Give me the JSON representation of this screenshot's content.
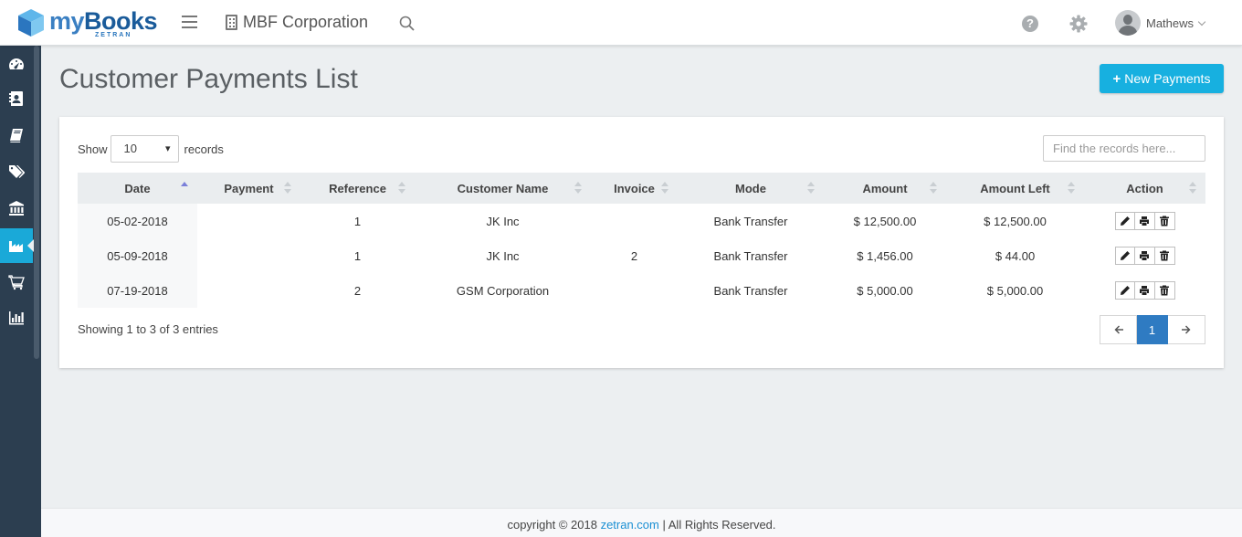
{
  "brand": {
    "name_my": "my",
    "name_books": "Books",
    "sub": "ZETRAN"
  },
  "header": {
    "company": "MBF Corporation",
    "user": "Mathews"
  },
  "sidebar": {
    "items": [
      {
        "icon": "dashboard-icon"
      },
      {
        "icon": "contacts-icon"
      },
      {
        "icon": "book-icon"
      },
      {
        "icon": "tags-icon"
      },
      {
        "icon": "bank-icon"
      },
      {
        "icon": "factory-icon",
        "active": true
      },
      {
        "icon": "cart-icon"
      },
      {
        "icon": "bar-chart-icon"
      }
    ]
  },
  "page": {
    "title": "Customer Payments List",
    "new_button": "New Payments"
  },
  "table_controls": {
    "show_label": "Show",
    "page_size": "10",
    "records_label": "records",
    "search_placeholder": "Find the records here..."
  },
  "table": {
    "columns": [
      "Date",
      "Payment",
      "Reference",
      "Customer Name",
      "Invoice",
      "Mode",
      "Amount",
      "Amount Left",
      "Action"
    ],
    "rows": [
      {
        "date": "05-02-2018",
        "payment": "",
        "reference": "1",
        "customer": "JK Inc",
        "invoice": "",
        "mode": "Bank Transfer",
        "amount": "$ 12,500.00",
        "amount_left": "$ 12,500.00"
      },
      {
        "date": "05-09-2018",
        "payment": "",
        "reference": "1",
        "customer": "JK Inc",
        "invoice": "2",
        "mode": "Bank Transfer",
        "amount": "$ 1,456.00",
        "amount_left": "$ 44.00"
      },
      {
        "date": "07-19-2018",
        "payment": "",
        "reference": "2",
        "customer": "GSM Corporation",
        "invoice": "",
        "mode": "Bank Transfer",
        "amount": "$ 5,000.00",
        "amount_left": "$ 5,000.00"
      }
    ]
  },
  "pagination": {
    "summary": "Showing 1 to 3 of 3 entries",
    "current": "1"
  },
  "footer": {
    "prefix": "copyright © 2018 ",
    "link": "zetran.com",
    "suffix": " | All Rights Reserved."
  },
  "colors": {
    "accent": "#17b0e0",
    "sidebar": "#2c3e50",
    "pager_active": "#2f7bc2"
  }
}
